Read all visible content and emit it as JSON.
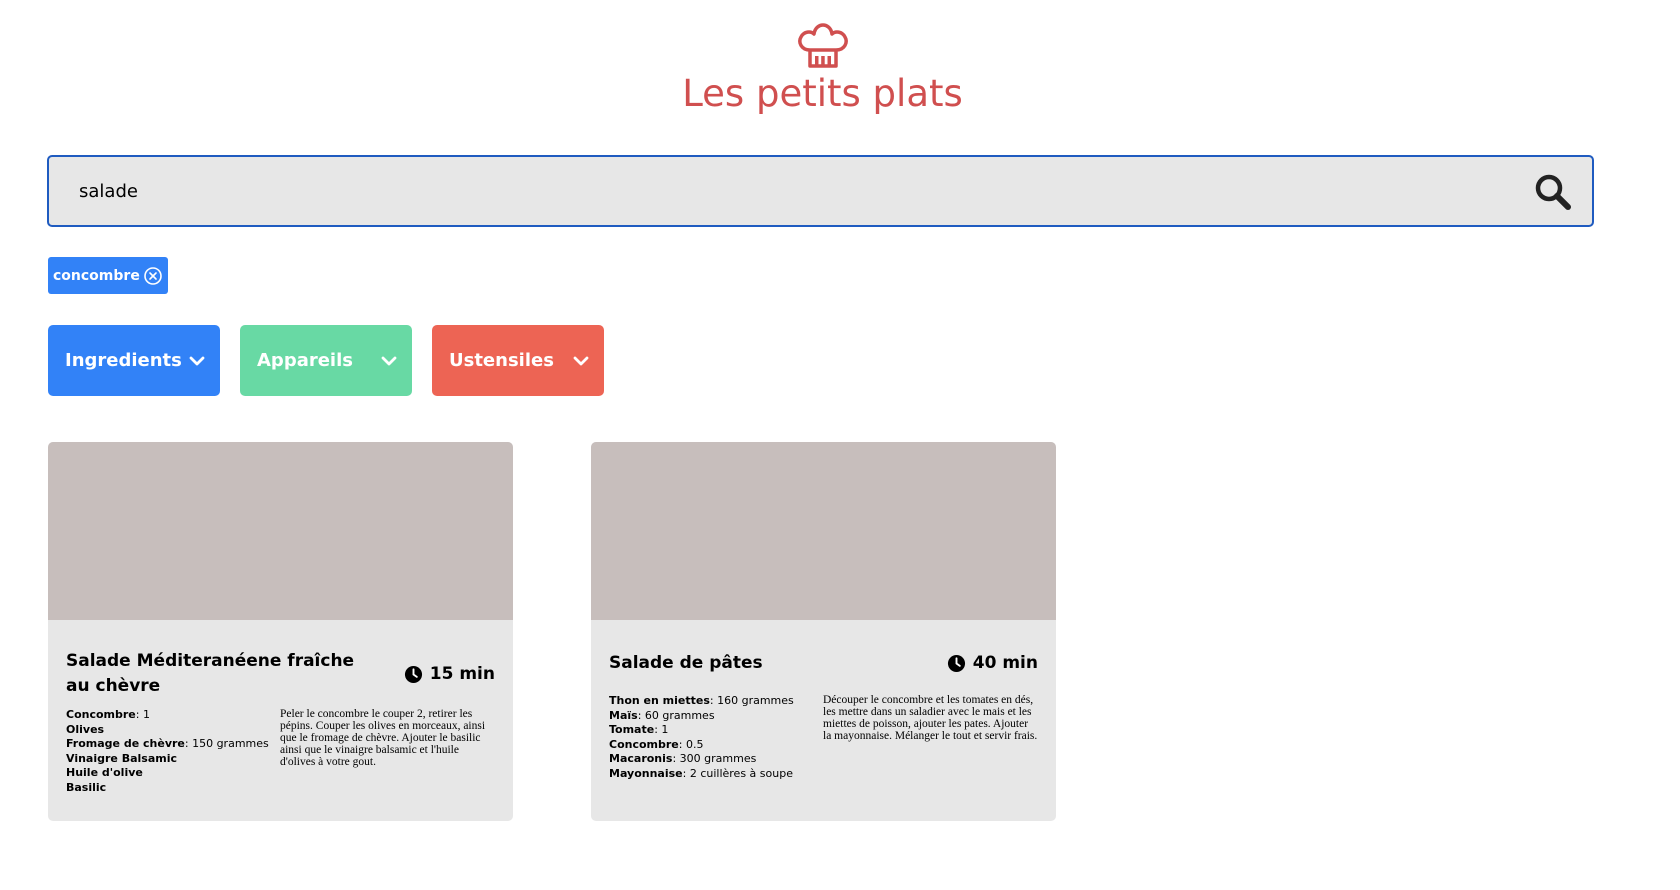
{
  "header": {
    "logo_icon": "chef-hat-icon",
    "title": "Les petits plats",
    "accent_color": "#D04F4F"
  },
  "search": {
    "value": "salade",
    "icon": "search-icon",
    "border_color": "#1F5BC0"
  },
  "tags": [
    {
      "label": "concombre",
      "color": "#3282F7",
      "icon": "close-circle-icon"
    }
  ],
  "filters": [
    {
      "label": "Ingredients",
      "color": "#3282F7",
      "icon": "chevron-down-icon"
    },
    {
      "label": "Appareils",
      "color": "#68D9A4",
      "icon": "chevron-down-icon"
    },
    {
      "label": "Ustensiles",
      "color": "#ED6454",
      "icon": "chevron-down-icon"
    }
  ],
  "recipes": [
    {
      "title": "Salade Méditeranéene fraîche au chèvre",
      "time": "15 min",
      "ingredients": [
        {
          "name": "Concombre",
          "qty": ": 1"
        },
        {
          "name": "Olives",
          "qty": ""
        },
        {
          "name": "Fromage de chèvre",
          "qty": ": 150 grammes"
        },
        {
          "name": "Vinaigre Balsamic",
          "qty": ""
        },
        {
          "name": "Huile d'olive",
          "qty": ""
        },
        {
          "name": "Basilic",
          "qty": ""
        }
      ],
      "description": "Peler le concombre le couper 2, retirer les pépins. Couper les olives en morceaux, ainsi que le fromage de chèvre. Ajouter le basilic ainsi que le vinaigre balsamic et l'huile d'olives à votre gout."
    },
    {
      "title": "Salade de pâtes",
      "time": "40 min",
      "ingredients": [
        {
          "name": "Thon en miettes",
          "qty": ": 160 grammes"
        },
        {
          "name": "Maïs",
          "qty": ": 60 grammes"
        },
        {
          "name": "Tomate",
          "qty": ": 1"
        },
        {
          "name": "Concombre",
          "qty": ": 0.5"
        },
        {
          "name": "Macaronis",
          "qty": ": 300 grammes"
        },
        {
          "name": "Mayonnaise",
          "qty": ": 2 cuillères à soupe"
        }
      ],
      "description": "Découper le concombre et les tomates en dés, les mettre dans un saladier avec le mais et les miettes de poisson, ajouter les pates. Ajouter la mayonnaise. Mélanger le tout et servir frais."
    }
  ]
}
